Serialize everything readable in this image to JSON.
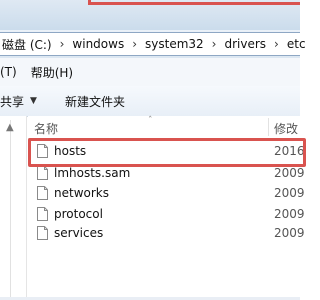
{
  "address": {
    "crumbs": [
      "磁盘 (C:)",
      "windows",
      "system32",
      "drivers",
      "etc"
    ],
    "separator": "›"
  },
  "menu": {
    "items": [
      "(T)",
      "帮助(H)"
    ]
  },
  "toolbar": {
    "share_label": "共享",
    "new_folder_label": "新建文件夹"
  },
  "columns": {
    "name": "名称",
    "modified": "修改"
  },
  "files": [
    {
      "name": "hosts",
      "date": "2016"
    },
    {
      "name": "lmhosts.sam",
      "date": "2009"
    },
    {
      "name": "networks",
      "date": "2009"
    },
    {
      "name": "protocol",
      "date": "2009"
    },
    {
      "name": "services",
      "date": "2009"
    }
  ],
  "colors": {
    "highlight": "#d9534f",
    "selection_red": "#d9534f"
  }
}
